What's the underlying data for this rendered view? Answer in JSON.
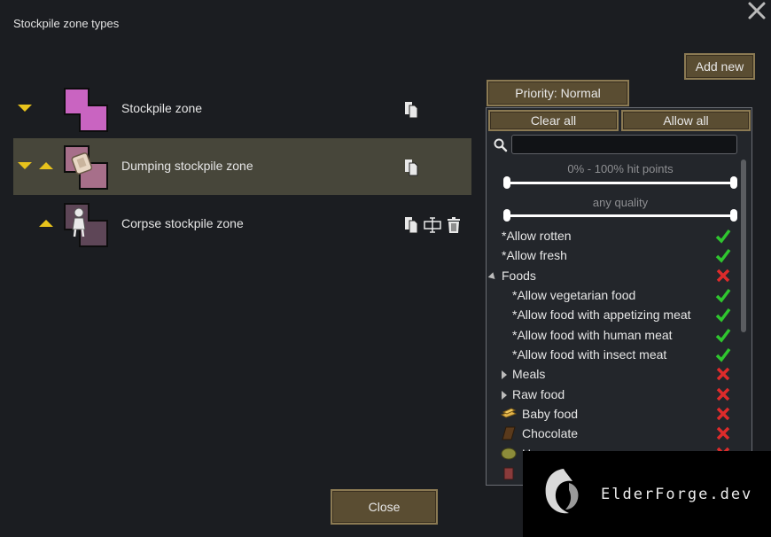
{
  "dialog": {
    "title": "Stockpile zone types",
    "add_new_label": "Add new",
    "close_label": "Close"
  },
  "zones": [
    {
      "label": "Stockpile zone",
      "color": "#c964c1",
      "selected": false
    },
    {
      "label": "Dumping stockpile zone",
      "color": "#a76f8a",
      "selected": true
    },
    {
      "label": "Corpse stockpile zone",
      "color": "#5e4657",
      "selected": false
    }
  ],
  "filter": {
    "priority_label": "Priority: Normal",
    "clear_all_label": "Clear all",
    "allow_all_label": "Allow all",
    "search_value": "",
    "hitpoints_label": "0% - 100% hit points",
    "quality_label": "any quality",
    "items": [
      {
        "label": "*Allow rotten",
        "state": "allowed"
      },
      {
        "label": "*Allow fresh",
        "state": "allowed"
      },
      {
        "label": "Foods",
        "state": "disallowed"
      },
      {
        "label": "*Allow vegetarian food",
        "state": "allowed"
      },
      {
        "label": "*Allow food with appetizing meat",
        "state": "allowed"
      },
      {
        "label": "*Allow food with human meat",
        "state": "allowed"
      },
      {
        "label": "*Allow food with insect meat",
        "state": "allowed"
      },
      {
        "label": "Meals",
        "state": "disallowed"
      },
      {
        "label": "Raw food",
        "state": "disallowed"
      },
      {
        "label": "Baby food",
        "state": "disallowed",
        "icon": "baby-food-icon"
      },
      {
        "label": "Chocolate",
        "state": "disallowed",
        "icon": "chocolate-icon"
      },
      {
        "label": "H",
        "state": "disallowed",
        "icon": "hay-icon"
      }
    ]
  },
  "watermark": {
    "text": "ElderForge.dev"
  },
  "colors": {
    "allowed": "#2fc52f",
    "disallowed": "#dd2b2b",
    "accent_arrow": "#e8c31c",
    "button": "#5a4d32"
  }
}
